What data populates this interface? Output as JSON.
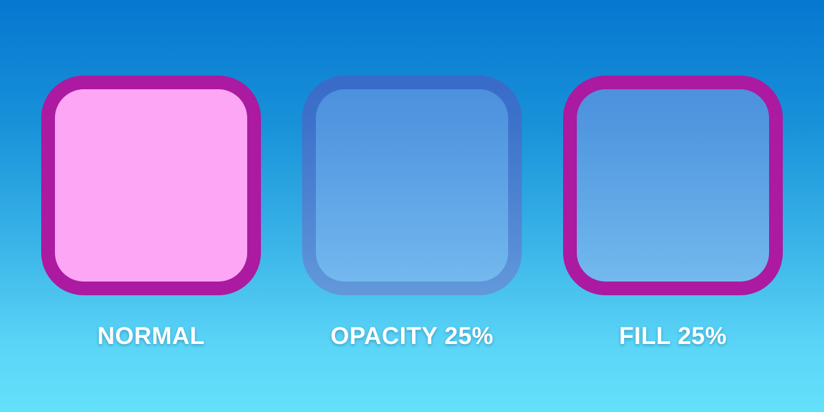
{
  "colors": {
    "background_top": "#0677d0",
    "background_bottom": "#63e0fb",
    "swatch_fill": "#fca6f5",
    "swatch_border": "#ab1aa1",
    "caption_text": "#ffffff"
  },
  "demos": [
    {
      "label": "NORMAL",
      "opacity": 1.0,
      "fill_opacity": 1.0
    },
    {
      "label": "OPACITY 25%",
      "opacity": 0.25,
      "fill_opacity": 1.0
    },
    {
      "label": "FILL 25%",
      "opacity": 1.0,
      "fill_opacity": 0.25
    }
  ]
}
